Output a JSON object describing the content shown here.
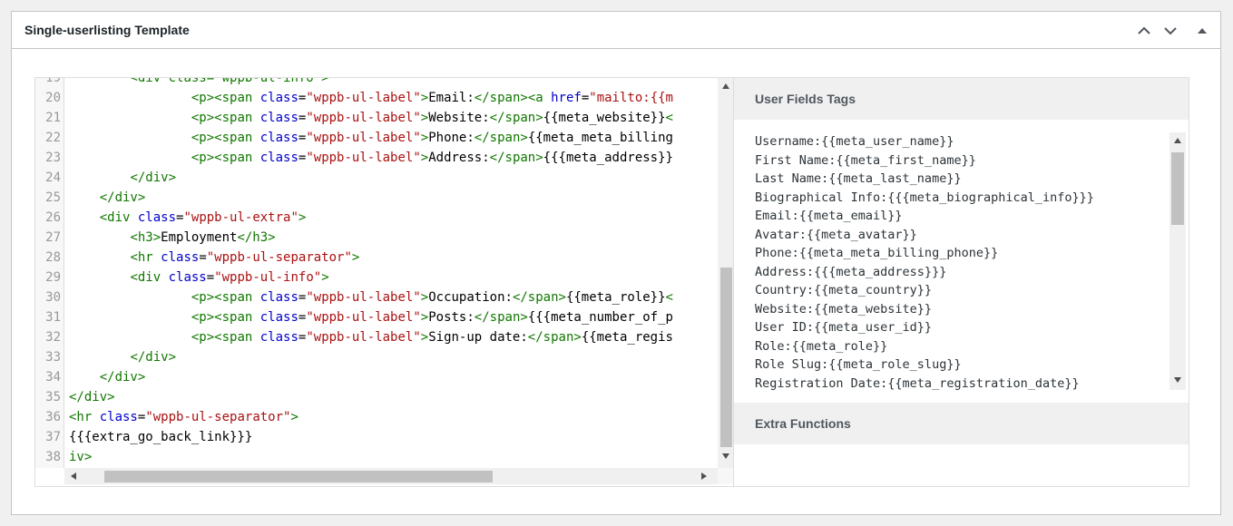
{
  "postbox": {
    "title": "Single-userlisting Template",
    "buttons": [
      "move-up",
      "move-down",
      "toggle-panel"
    ]
  },
  "editor": {
    "line_numbers": [
      "20",
      "21",
      "22",
      "23",
      "24",
      "25",
      "26",
      "27",
      "28",
      "29",
      "30",
      "31",
      "32",
      "33",
      "34",
      "35",
      "36",
      "37",
      "38"
    ],
    "partial_top_text": "<div class=\"wppb-ul-info\">",
    "lines": [
      [
        [
          "    <p>",
          "tg"
        ],
        [
          "<span ",
          "tg"
        ],
        [
          "class",
          "at"
        ],
        [
          "=",
          ""
        ],
        [
          "\"wppb-ul-label\"",
          "st"
        ],
        [
          ">",
          "tg"
        ],
        [
          "Email:",
          ""
        ],
        [
          "</span>",
          "tg"
        ],
        [
          "<a ",
          "tg"
        ],
        [
          "href",
          "at"
        ],
        [
          "=",
          ""
        ],
        [
          "\"mailto:{{m",
          "st"
        ]
      ],
      [
        [
          "    <p>",
          "tg"
        ],
        [
          "<span ",
          "tg"
        ],
        [
          "class",
          "at"
        ],
        [
          "=",
          ""
        ],
        [
          "\"wppb-ul-label\"",
          "st"
        ],
        [
          ">",
          "tg"
        ],
        [
          "Website:",
          ""
        ],
        [
          "</span>",
          "tg"
        ],
        [
          "{{meta_website}}",
          ""
        ],
        [
          "<",
          "tg"
        ]
      ],
      [
        [
          "    <p>",
          "tg"
        ],
        [
          "<span ",
          "tg"
        ],
        [
          "class",
          "at"
        ],
        [
          "=",
          ""
        ],
        [
          "\"wppb-ul-label\"",
          "st"
        ],
        [
          ">",
          "tg"
        ],
        [
          "Phone:",
          ""
        ],
        [
          "</span>",
          "tg"
        ],
        [
          "{{meta_meta_billing",
          ""
        ]
      ],
      [
        [
          "    <p>",
          "tg"
        ],
        [
          "<span ",
          "tg"
        ],
        [
          "class",
          "at"
        ],
        [
          "=",
          ""
        ],
        [
          "\"wppb-ul-label\"",
          "st"
        ],
        [
          ">",
          "tg"
        ],
        [
          "Address:",
          ""
        ],
        [
          "</span>",
          "tg"
        ],
        [
          "{{{meta_address}}",
          ""
        ]
      ],
      [
        [
          "</div>",
          "tg"
        ]
      ],
      [
        [
          "</div>",
          "tg"
        ]
      ],
      [
        [
          "<div ",
          "tg"
        ],
        [
          "class",
          "at"
        ],
        [
          "=",
          ""
        ],
        [
          "\"wppb-ul-extra\"",
          "st"
        ],
        [
          ">",
          "tg"
        ]
      ],
      [
        [
          "<h3>",
          "tg"
        ],
        [
          "Employment",
          ""
        ],
        [
          "</h3>",
          "tg"
        ]
      ],
      [
        [
          "<hr ",
          "tg"
        ],
        [
          "class",
          "at"
        ],
        [
          "=",
          ""
        ],
        [
          "\"wppb-ul-separator\"",
          "st"
        ],
        [
          ">",
          "tg"
        ]
      ],
      [
        [
          "<div ",
          "tg"
        ],
        [
          "class",
          "at"
        ],
        [
          "=",
          ""
        ],
        [
          "\"wppb-ul-info\"",
          "st"
        ],
        [
          ">",
          "tg"
        ]
      ],
      [
        [
          "    <p>",
          "tg"
        ],
        [
          "<span ",
          "tg"
        ],
        [
          "class",
          "at"
        ],
        [
          "=",
          ""
        ],
        [
          "\"wppb-ul-label\"",
          "st"
        ],
        [
          ">",
          "tg"
        ],
        [
          "Occupation:",
          ""
        ],
        [
          "</span>",
          "tg"
        ],
        [
          "{{meta_role}}",
          ""
        ],
        [
          "<",
          "tg"
        ]
      ],
      [
        [
          "    <p>",
          "tg"
        ],
        [
          "<span ",
          "tg"
        ],
        [
          "class",
          "at"
        ],
        [
          "=",
          ""
        ],
        [
          "\"wppb-ul-label\"",
          "st"
        ],
        [
          ">",
          "tg"
        ],
        [
          "Posts:",
          ""
        ],
        [
          "</span>",
          "tg"
        ],
        [
          "{{{meta_number_of_p",
          ""
        ]
      ],
      [
        [
          "    <p>",
          "tg"
        ],
        [
          "<span ",
          "tg"
        ],
        [
          "class",
          "at"
        ],
        [
          "=",
          ""
        ],
        [
          "\"wppb-ul-label\"",
          "st"
        ],
        [
          ">",
          "tg"
        ],
        [
          "Sign-up date:",
          ""
        ],
        [
          "</span>",
          "tg"
        ],
        [
          "{{meta_regis",
          ""
        ]
      ],
      [
        [
          "</div>",
          "tg"
        ]
      ],
      [
        [
          "</div>",
          "tg"
        ]
      ],
      [
        [
          "</div>",
          "tg"
        ]
      ],
      [
        [
          "<hr ",
          "tg"
        ],
        [
          "class",
          "at"
        ],
        [
          "=",
          ""
        ],
        [
          "\"wppb-ul-separator\"",
          "st"
        ],
        [
          ">",
          "tg"
        ]
      ],
      [
        [
          "{{{extra_go_back_link}}}",
          ""
        ]
      ],
      [
        [
          "iv>",
          "tg"
        ]
      ]
    ]
  },
  "tags_panel": {
    "user_fields_title": "User Fields Tags",
    "extra_functions_title": "Extra Functions",
    "tags": [
      "Username:{{meta_user_name}}",
      "First Name:{{meta_first_name}}",
      "Last Name:{{meta_last_name}}",
      "Biographical Info:{{{meta_biographical_info}}}",
      "Email:{{meta_email}}",
      "Avatar:{{meta_avatar}}",
      "Phone:{{meta_meta_billing_phone}}",
      "Address:{{{meta_address}}}",
      "Country:{{meta_country}}",
      "Website:{{meta_website}}",
      "User ID:{{meta_user_id}}",
      "Role:{{meta_role}}",
      "Role Slug:{{meta_role_slug}}",
      "Registration Date:{{meta_registration_date}}"
    ]
  },
  "colors": {
    "tag": "#117700",
    "attribute": "#0000cc",
    "string": "#aa1111"
  }
}
